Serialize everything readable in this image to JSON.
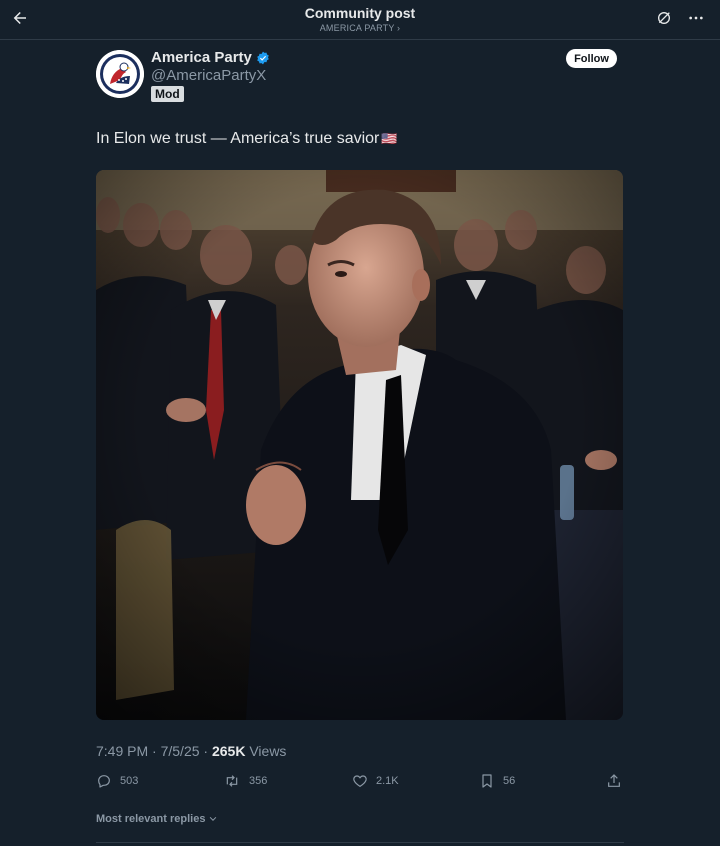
{
  "header": {
    "title": "Community post",
    "subtitle": "AMERICA PARTY ›"
  },
  "author": {
    "name": "America Party",
    "handle": "@AmericaPartyX",
    "badge": "Mod",
    "follow_label": "Follow",
    "verified_color": "#1d9bf0"
  },
  "post": {
    "text": "In Elon we trust — America’s true savior",
    "flag_emoji": "🇺🇸",
    "time": "7:49 PM",
    "date": "7/5/25",
    "views_count": "265K",
    "views_label": "Views"
  },
  "actions": {
    "replies": "503",
    "reposts": "356",
    "likes": "2.1K",
    "bookmarks": "56"
  },
  "replies_sort": "Most relevant replies",
  "colors": {
    "background": "#15202b",
    "text_primary": "#e7e9ea",
    "text_secondary": "#8b98a5",
    "divider": "#2f3b47"
  },
  "icons": [
    "back-arrow-icon",
    "grok-icon",
    "more-icon",
    "verified-icon",
    "reply-icon",
    "repost-icon",
    "like-icon",
    "bookmark-icon",
    "share-icon",
    "chevron-down-icon"
  ]
}
